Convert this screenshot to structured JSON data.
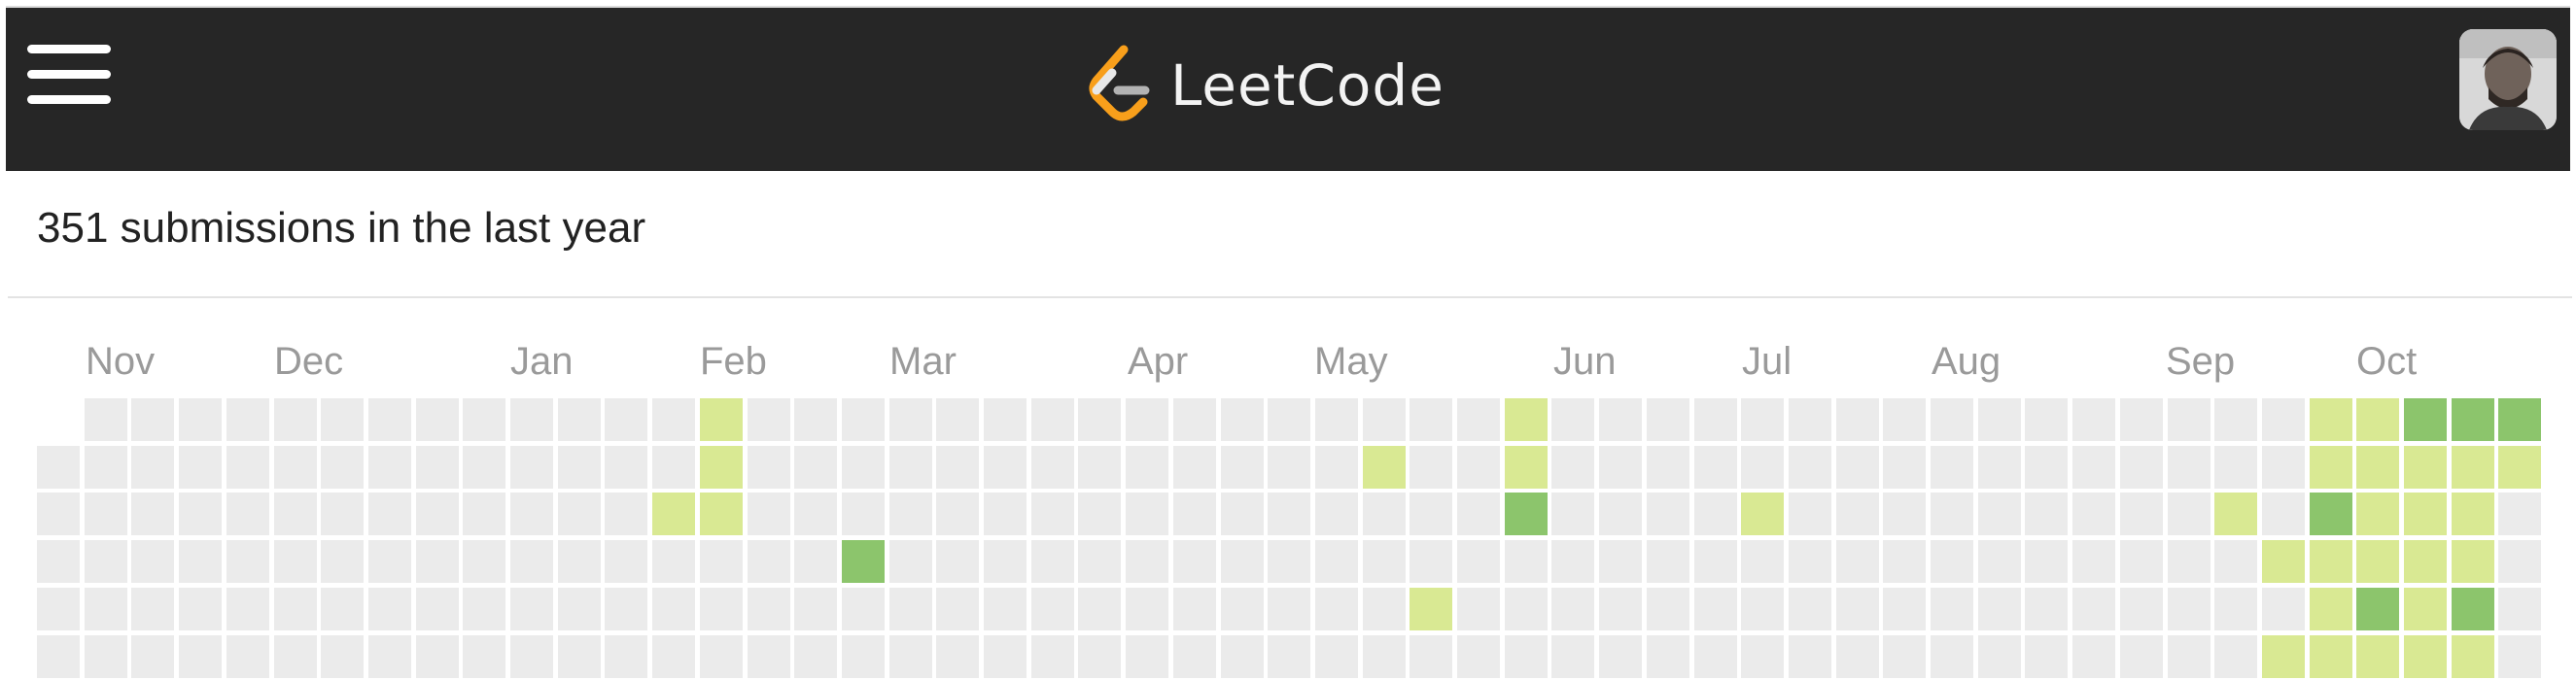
{
  "header": {
    "brand_name": "LeetCode",
    "menu_icon": "hamburger-menu-icon",
    "logo_icon": "leetcode-logo-icon",
    "avatar_icon": "user-avatar"
  },
  "summary": {
    "title": "351 submissions in the last year"
  },
  "calendar": {
    "months": [
      "Nov",
      "Dec",
      "Jan",
      "Feb",
      "Mar",
      "Apr",
      "May",
      "Jun",
      "Jul",
      "Aug",
      "Sep",
      "Oct"
    ],
    "weeks_visible": 53,
    "rows_visible": 6,
    "colors": {
      "empty": "#ebebeb",
      "level1": "#d9e993",
      "level2": "#8cc56c"
    },
    "activity": [
      {
        "week": 14,
        "day": 0,
        "level": 1
      },
      {
        "week": 14,
        "day": 1,
        "level": 1
      },
      {
        "week": 13,
        "day": 2,
        "level": 1
      },
      {
        "week": 14,
        "day": 2,
        "level": 1
      },
      {
        "week": 17,
        "day": 3,
        "level": 2
      },
      {
        "week": 28,
        "day": 1,
        "level": 1
      },
      {
        "week": 29,
        "day": 4,
        "level": 1
      },
      {
        "week": 31,
        "day": 0,
        "level": 1
      },
      {
        "week": 31,
        "day": 1,
        "level": 1
      },
      {
        "week": 31,
        "day": 2,
        "level": 2
      },
      {
        "week": 36,
        "day": 2,
        "level": 1
      },
      {
        "week": 46,
        "day": 2,
        "level": 1
      },
      {
        "week": 47,
        "day": 3,
        "level": 1
      },
      {
        "week": 47,
        "day": 5,
        "level": 1
      },
      {
        "week": 48,
        "day": 0,
        "level": 1
      },
      {
        "week": 48,
        "day": 1,
        "level": 1
      },
      {
        "week": 48,
        "day": 2,
        "level": 2
      },
      {
        "week": 48,
        "day": 3,
        "level": 1
      },
      {
        "week": 48,
        "day": 4,
        "level": 1
      },
      {
        "week": 48,
        "day": 5,
        "level": 1
      },
      {
        "week": 49,
        "day": 0,
        "level": 1
      },
      {
        "week": 49,
        "day": 1,
        "level": 1
      },
      {
        "week": 49,
        "day": 2,
        "level": 1
      },
      {
        "week": 49,
        "day": 3,
        "level": 1
      },
      {
        "week": 49,
        "day": 4,
        "level": 2
      },
      {
        "week": 49,
        "day": 5,
        "level": 1
      },
      {
        "week": 50,
        "day": 0,
        "level": 2
      },
      {
        "week": 50,
        "day": 1,
        "level": 1
      },
      {
        "week": 50,
        "day": 2,
        "level": 1
      },
      {
        "week": 50,
        "day": 3,
        "level": 1
      },
      {
        "week": 50,
        "day": 4,
        "level": 1
      },
      {
        "week": 50,
        "day": 5,
        "level": 1
      },
      {
        "week": 51,
        "day": 0,
        "level": 2
      },
      {
        "week": 51,
        "day": 1,
        "level": 1
      },
      {
        "week": 51,
        "day": 2,
        "level": 1
      },
      {
        "week": 51,
        "day": 3,
        "level": 1
      },
      {
        "week": 51,
        "day": 4,
        "level": 2
      },
      {
        "week": 51,
        "day": 5,
        "level": 1
      },
      {
        "week": 52,
        "day": 0,
        "level": 2
      },
      {
        "week": 52,
        "day": 1,
        "level": 1
      }
    ]
  }
}
